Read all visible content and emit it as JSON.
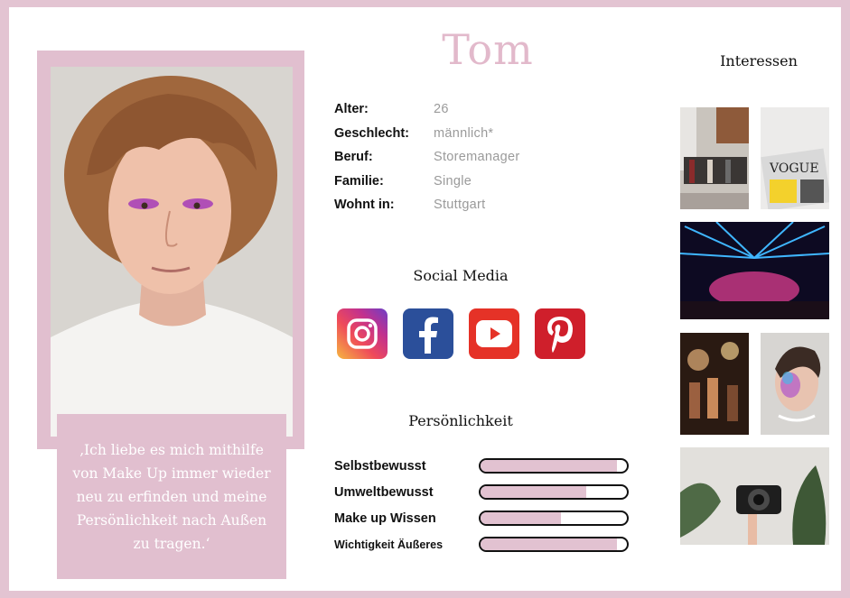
{
  "persona": {
    "name": "Tom",
    "quote": "‚Ich liebe es mich mithilfe von Make Up immer wieder neu zu erfinden und meine Persönlichkeit nach Außen zu tragen.‘"
  },
  "facts": [
    {
      "label": "Alter:",
      "value": "26"
    },
    {
      "label": "Geschlecht:",
      "value": "männlich*"
    },
    {
      "label": "Beruf:",
      "value": "Storemanager"
    },
    {
      "label": "Familie:",
      "value": "Single"
    },
    {
      "label": "Wohnt in:",
      "value": "Stuttgart"
    }
  ],
  "social": {
    "title": "Social Media",
    "icons": [
      "instagram-icon",
      "facebook-icon",
      "youtube-icon",
      "pinterest-icon"
    ]
  },
  "personality": {
    "title": "Persönlichkeit",
    "traits": [
      {
        "label": "Selbstbewusst",
        "level": 0.93
      },
      {
        "label": "Umweltbewusst",
        "level": 0.72
      },
      {
        "label": "Make up Wissen",
        "level": 0.55
      },
      {
        "label": "Wichtigkeit Äußeres",
        "level": 0.93
      }
    ]
  },
  "interests": {
    "title": "Interessen",
    "images": [
      "clothing-store-photo",
      "vogue-magazines-photo",
      "nightclub-lights-photo",
      "party-crowd-photo",
      "glitter-makeup-face-photo",
      "camera-plants-photo"
    ]
  },
  "colors": {
    "accent": "#e1bfcf",
    "name": "#e2b9cb",
    "background": "#e3c4d2"
  }
}
